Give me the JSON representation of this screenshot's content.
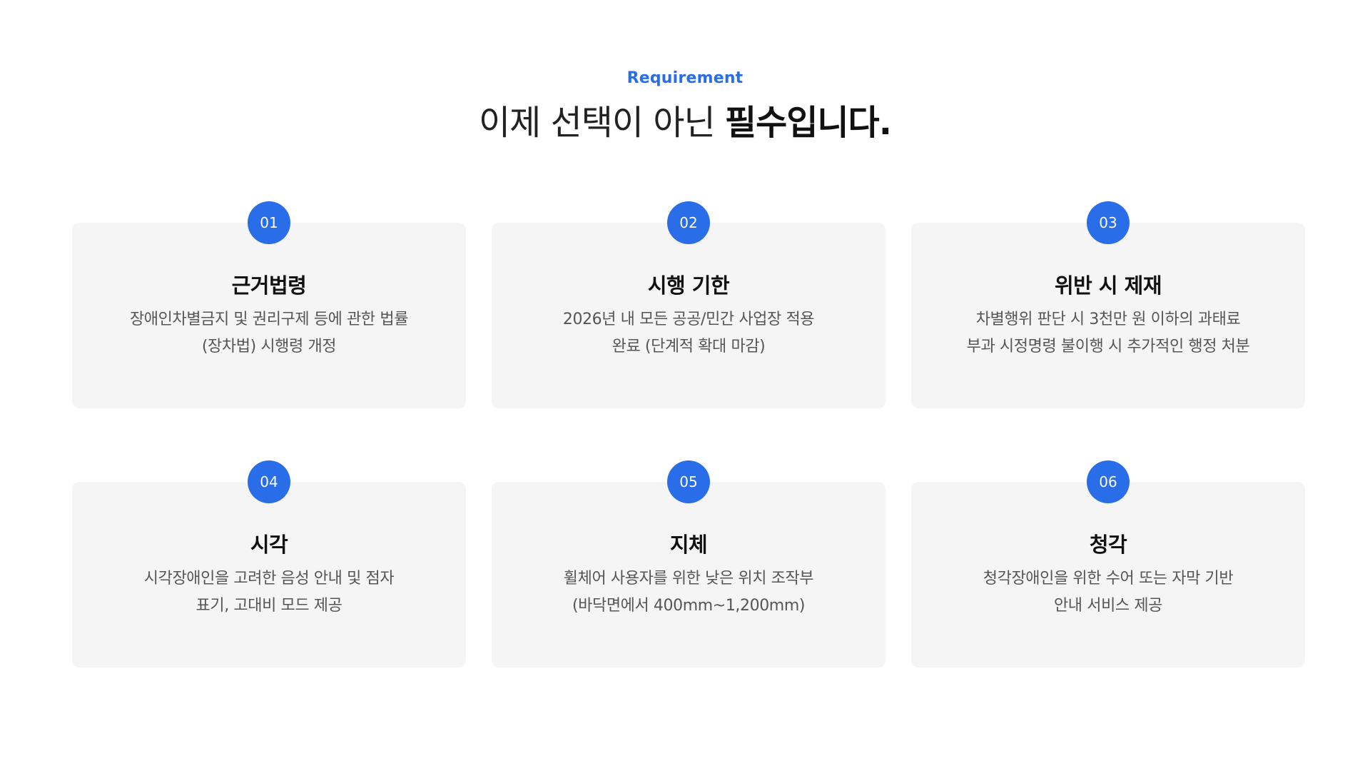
{
  "header": {
    "eyebrow": "Requirement",
    "headline_light": "이제 선택이 아닌 ",
    "headline_bold": "필수입니다."
  },
  "colors": {
    "accent": "#2a6de9",
    "card_bg": "#f5f5f5",
    "text_primary": "#111111",
    "text_secondary": "#555555"
  },
  "cards": [
    {
      "number": "01",
      "title": "근거법령",
      "desc_line1": "장애인차별금지 및 권리구제 등에 관한 법률",
      "desc_line2": "(장차법) 시행령 개정"
    },
    {
      "number": "02",
      "title": "시행 기한",
      "desc_line1": "2026년 내 모든 공공/민간 사업장 적용",
      "desc_line2": "완료 (단계적 확대 마감)"
    },
    {
      "number": "03",
      "title": "위반 시 제재",
      "desc_line1": "차별행위 판단 시 3천만 원 이하의 과태료",
      "desc_line2": "부과 시정명령 불이행 시 추가적인 행정 처분"
    },
    {
      "number": "04",
      "title": "시각",
      "desc_line1": "시각장애인을 고려한 음성 안내 및 점자",
      "desc_line2": "표기, 고대비 모드 제공"
    },
    {
      "number": "05",
      "title": "지체",
      "desc_line1": "휠체어 사용자를 위한 낮은 위치 조작부",
      "desc_line2": "(바닥면에서 400mm~1,200mm)"
    },
    {
      "number": "06",
      "title": "청각",
      "desc_line1": "청각장애인을 위한 수어 또는 자막 기반",
      "desc_line2": "안내 서비스 제공"
    }
  ]
}
